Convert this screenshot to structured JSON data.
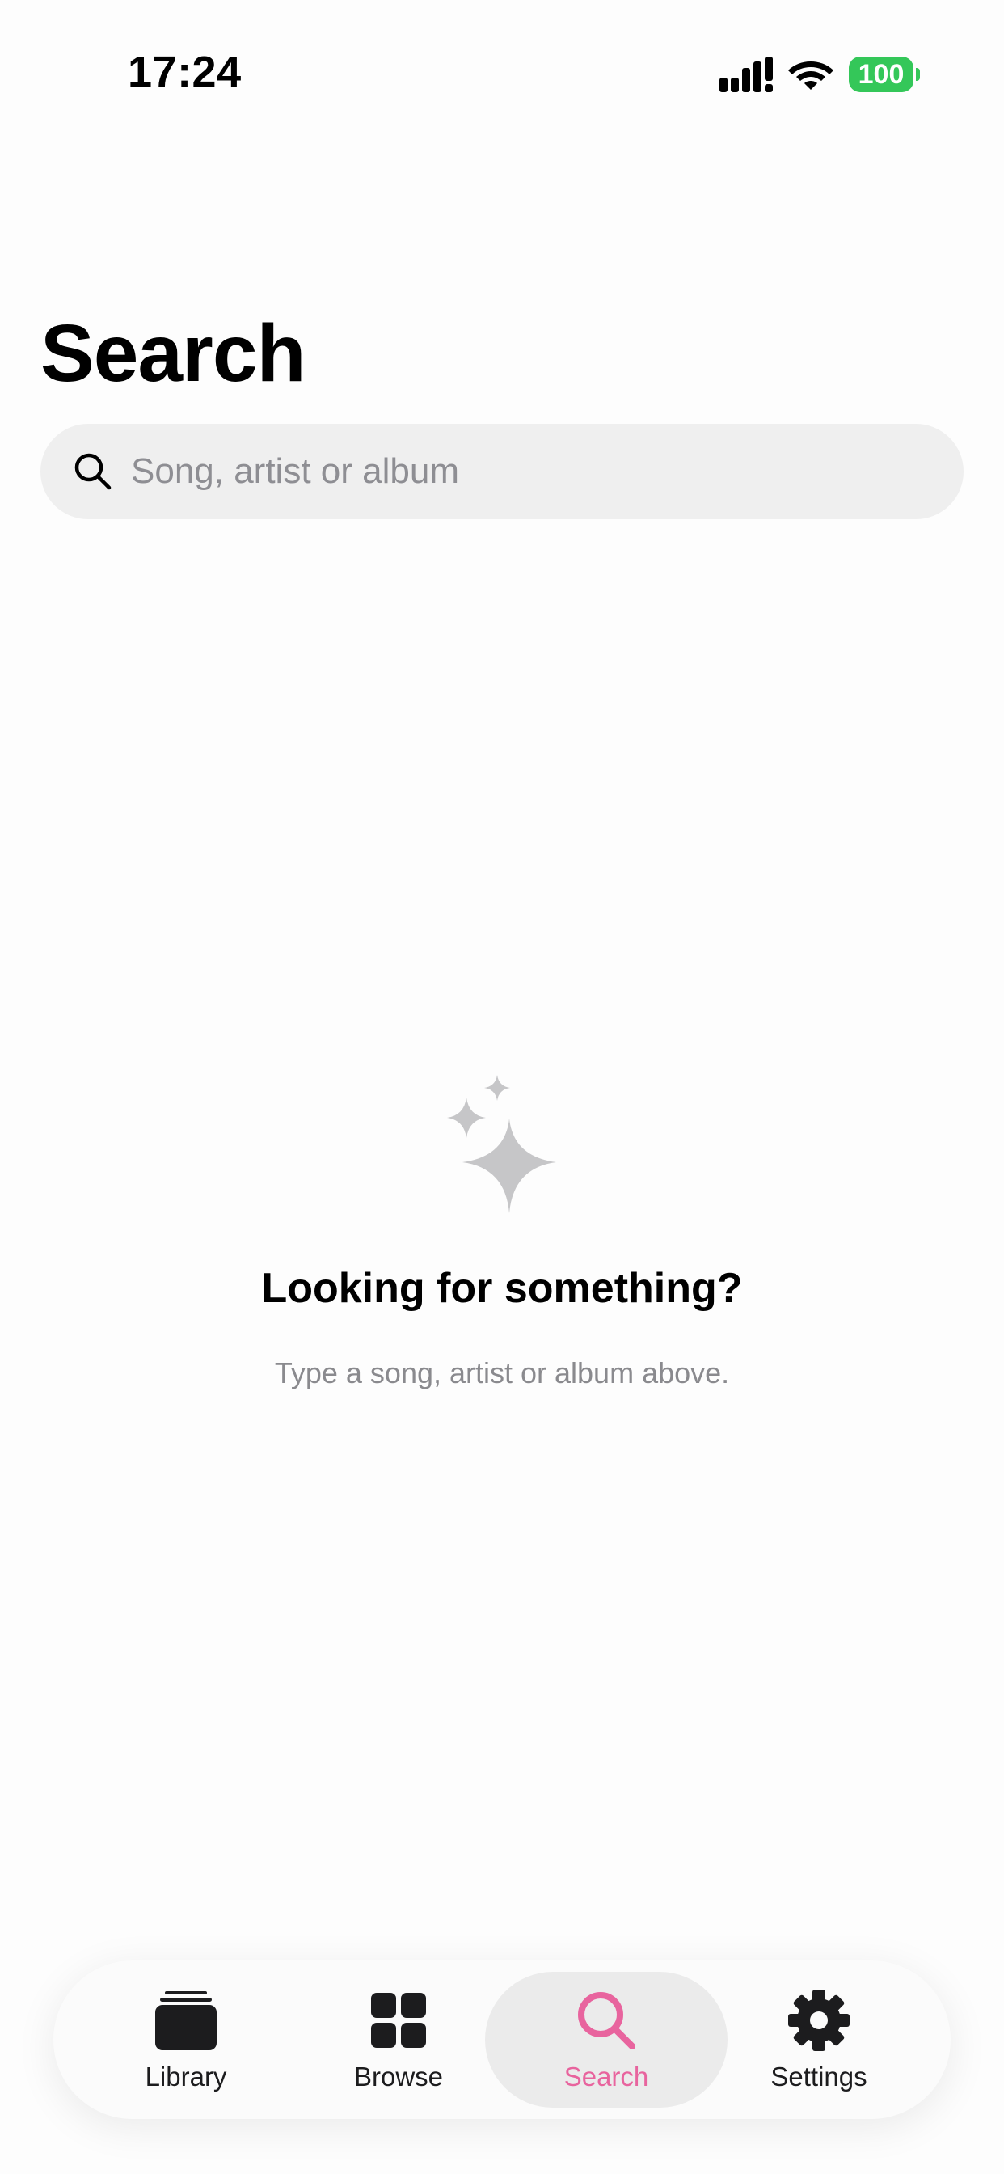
{
  "status_bar": {
    "time": "17:24",
    "battery": "100",
    "battery_color": "#34c759"
  },
  "page": {
    "title": "Search"
  },
  "search": {
    "placeholder": "Song, artist or album",
    "value": ""
  },
  "empty_state": {
    "icon": "sparkles-icon",
    "title": "Looking for something?",
    "subtitle": "Type a song, artist or album above."
  },
  "tab_bar": {
    "accent_color": "#e8649e",
    "tabs": [
      {
        "label": "Library",
        "icon": "library-stack-icon",
        "selected": false
      },
      {
        "label": "Browse",
        "icon": "grid-icon",
        "selected": false
      },
      {
        "label": "Search",
        "icon": "search-icon",
        "selected": true
      },
      {
        "label": "Settings",
        "icon": "gear-icon",
        "selected": false
      }
    ]
  }
}
